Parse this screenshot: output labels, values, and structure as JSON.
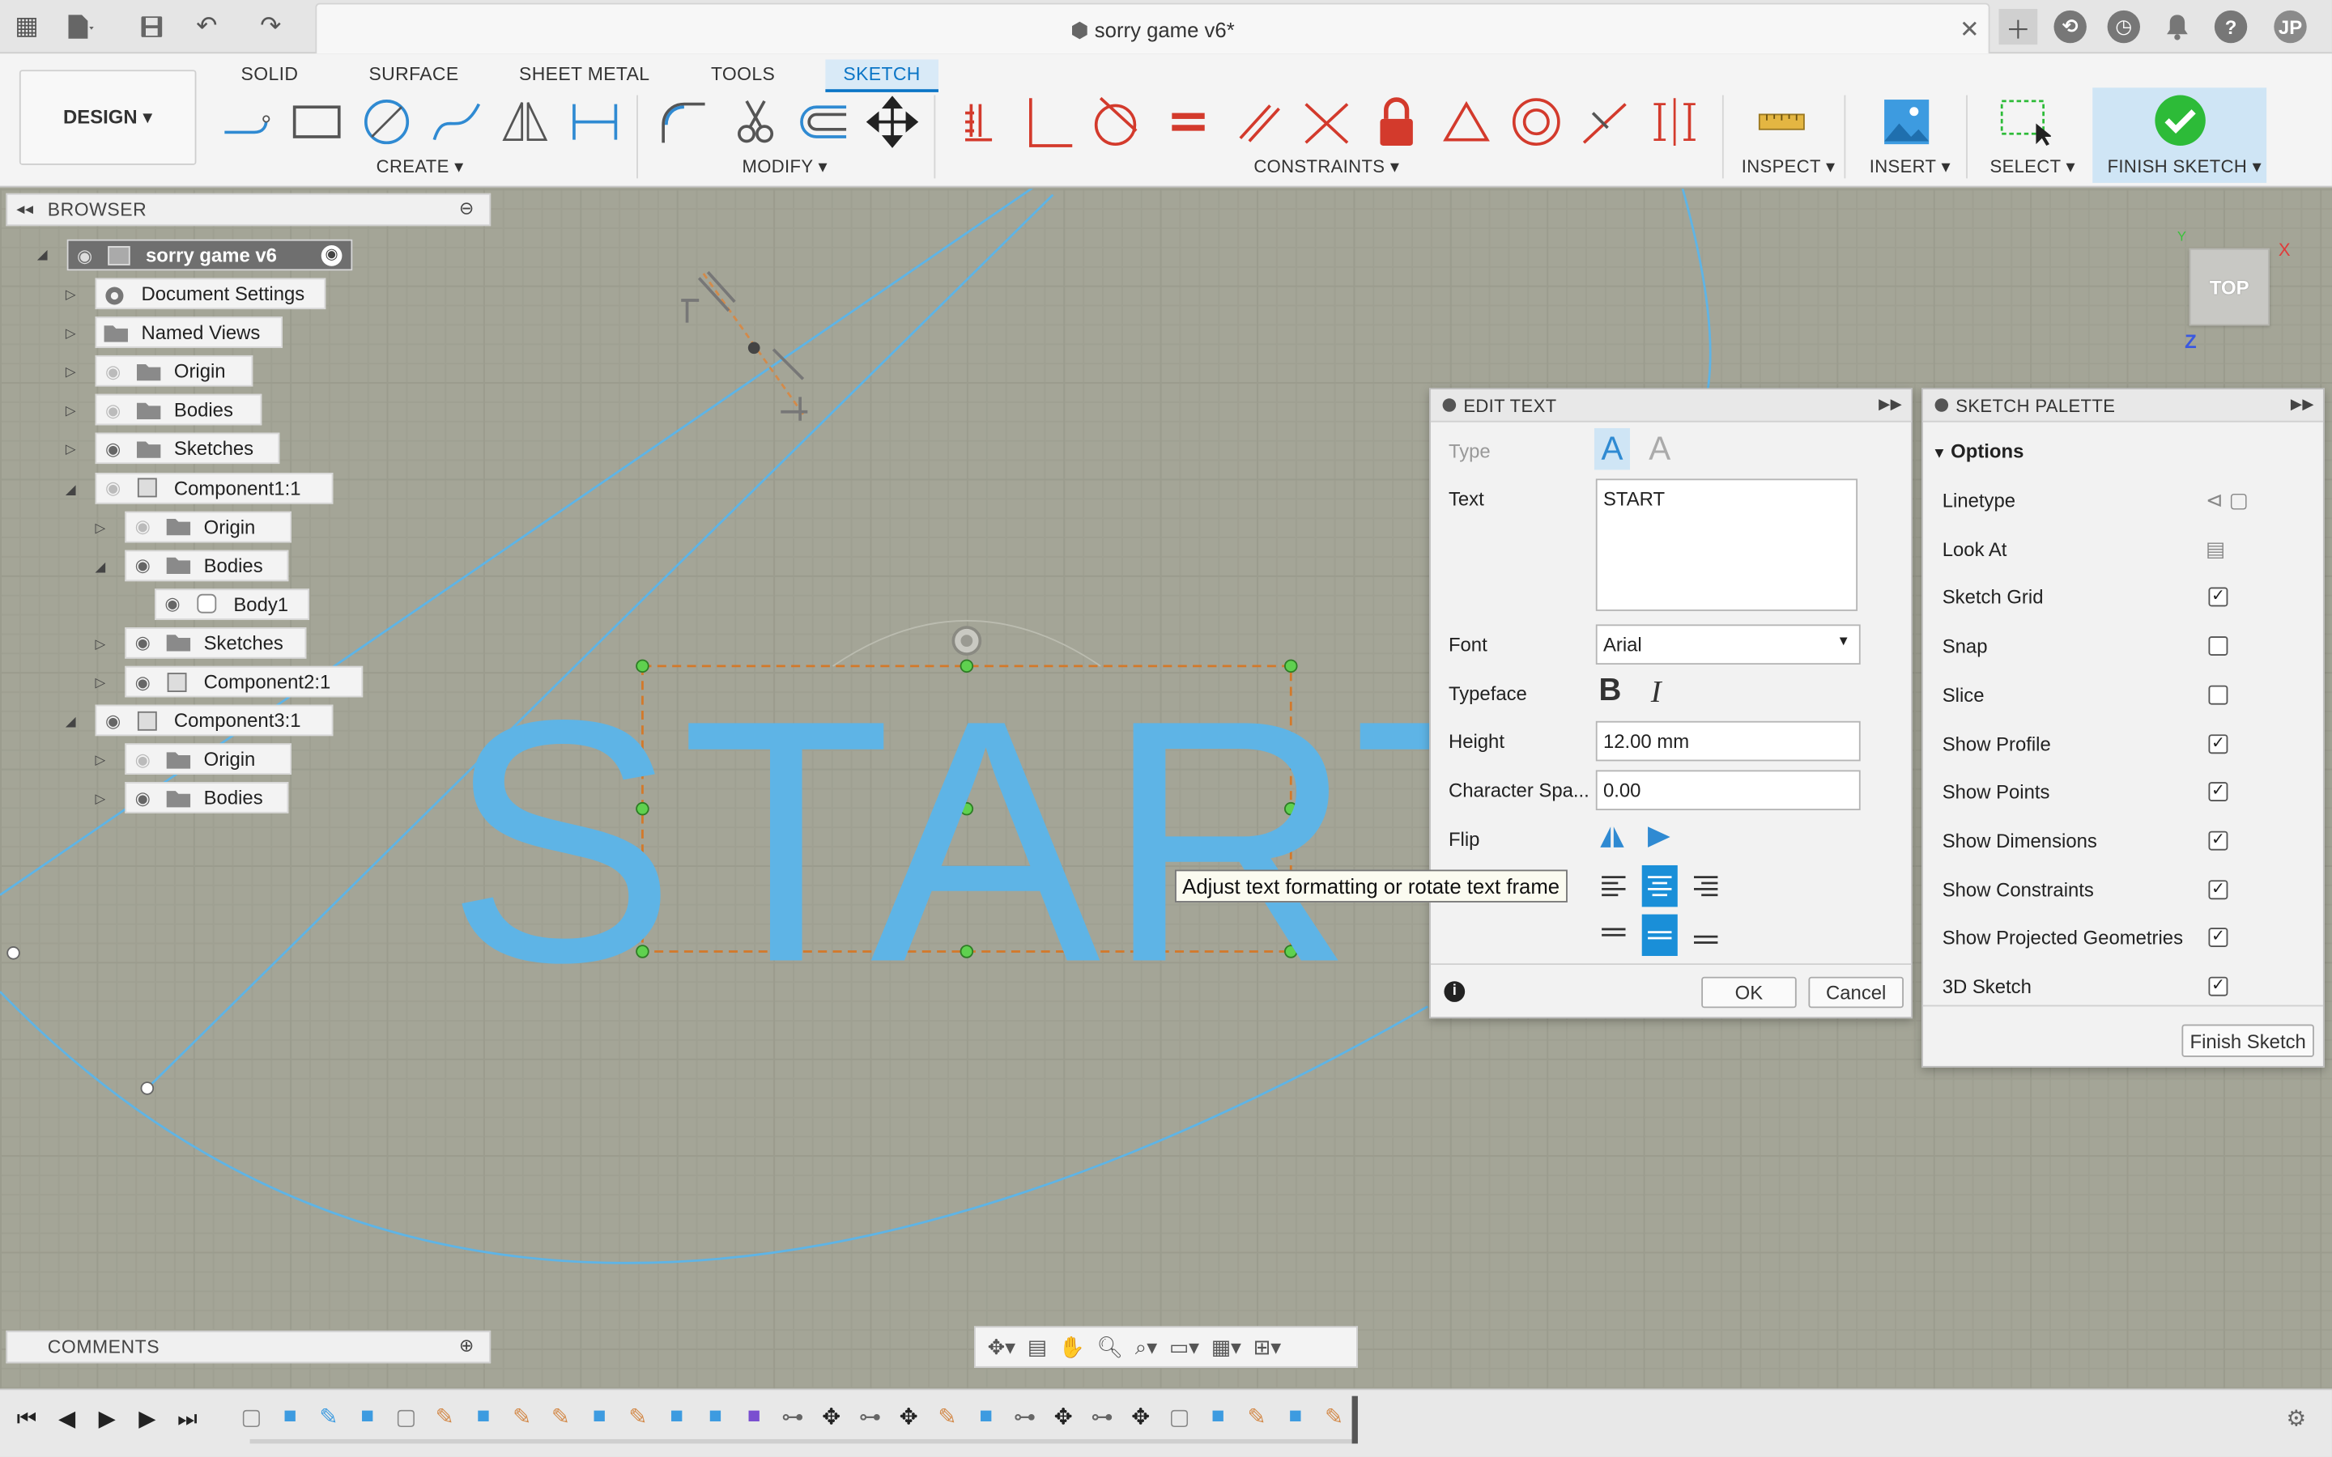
{
  "app": {
    "document_title": "sorry game v6*",
    "user_initials": "JP"
  },
  "ribbon": {
    "tabs": [
      "SOLID",
      "SURFACE",
      "SHEET METAL",
      "TOOLS",
      "SKETCH"
    ],
    "active_tab": "SKETCH",
    "workspace": "DESIGN ▾",
    "groups": {
      "create": "CREATE ▾",
      "modify": "MODIFY ▾",
      "constraints": "CONSTRAINTS ▾",
      "inspect": "INSPECT ▾",
      "insert": "INSERT ▾",
      "select": "SELECT ▾",
      "finish": "FINISH SKETCH ▾"
    }
  },
  "browser": {
    "title": "BROWSER",
    "root": "sorry game v6",
    "items": [
      {
        "label": "Document Settings",
        "icon": "gear-icon"
      },
      {
        "label": "Named Views",
        "icon": "folder-icon"
      },
      {
        "label": "Origin",
        "icon": "folder-icon"
      },
      {
        "label": "Bodies",
        "icon": "folder-icon"
      },
      {
        "label": "Sketches",
        "icon": "folder-icon"
      },
      {
        "label": "Component1:1",
        "icon": "component-icon"
      },
      {
        "label": "Origin",
        "icon": "folder-icon"
      },
      {
        "label": "Bodies",
        "icon": "folder-icon"
      },
      {
        "label": "Body1",
        "icon": "body-icon"
      },
      {
        "label": "Sketches",
        "icon": "folder-icon"
      },
      {
        "label": "Component2:1",
        "icon": "component-icon"
      },
      {
        "label": "Component3:1",
        "icon": "component-icon"
      },
      {
        "label": "Origin",
        "icon": "folder-icon"
      },
      {
        "label": "Bodies",
        "icon": "folder-icon"
      }
    ]
  },
  "canvas": {
    "sketch_text": "START",
    "viewcube_label": "TOP",
    "axis_labels": {
      "x": "X",
      "y": "Y",
      "z": "Z"
    },
    "tooltip": "Adjust text formatting or rotate text frame"
  },
  "edit_text": {
    "title": "EDIT TEXT",
    "type_label": "Type",
    "text_label": "Text",
    "text_value": "START",
    "font_label": "Font",
    "font_value": "Arial",
    "typeface_label": "Typeface",
    "height_label": "Height",
    "height_value": "12.00 mm",
    "spacing_label": "Character Spa...",
    "spacing_value": "0.00",
    "flip_label": "Flip",
    "ok": "OK",
    "cancel": "Cancel"
  },
  "sketch_palette": {
    "title": "SKETCH PALETTE",
    "section": "Options",
    "options": [
      {
        "label": "Linetype",
        "kind": "icon"
      },
      {
        "label": "Look At",
        "kind": "icon"
      },
      {
        "label": "Sketch Grid",
        "checked": true
      },
      {
        "label": "Snap",
        "checked": false
      },
      {
        "label": "Slice",
        "checked": false
      },
      {
        "label": "Show Profile",
        "checked": true
      },
      {
        "label": "Show Points",
        "checked": true
      },
      {
        "label": "Show Dimensions",
        "checked": true
      },
      {
        "label": "Show Constraints",
        "checked": true
      },
      {
        "label": "Show Projected Geometries",
        "checked": true
      },
      {
        "label": "3D Sketch",
        "checked": true
      }
    ],
    "finish_button": "Finish Sketch"
  },
  "comments": {
    "title": "COMMENTS"
  },
  "colors": {
    "accent": "#0b75c6",
    "sketch_blue": "#5eb4e6",
    "finish_green": "#2dbb38",
    "constraint_red": "#d33a2c"
  }
}
